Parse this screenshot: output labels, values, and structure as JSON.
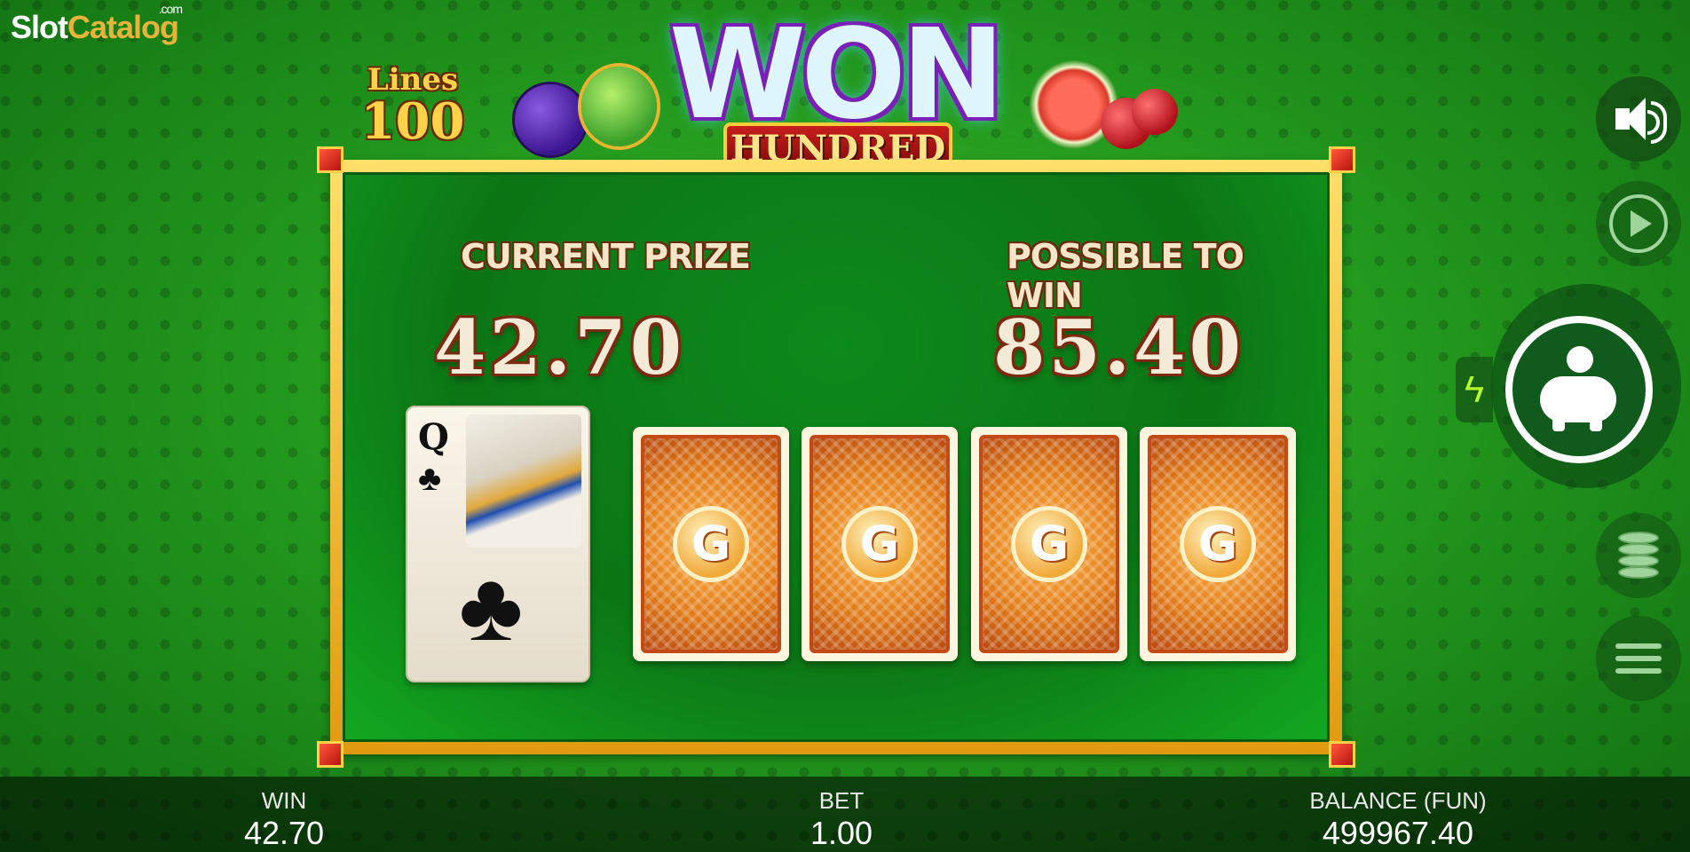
{
  "watermark": {
    "part1": "Slot",
    "part2": "Catalog",
    "suffix": ".com"
  },
  "header": {
    "lines_label": "Lines",
    "lines_value": "100",
    "title_main": "WON",
    "title_sub": "HUNDRED"
  },
  "gamble": {
    "current_prize_label": "CURRENT PRIZE",
    "current_prize_value": "42.70",
    "possible_label": "POSSIBLE TO WIN",
    "possible_value": "85.40",
    "revealed_card": {
      "rank": "Q",
      "suit": "♣"
    },
    "hidden_cards": [
      "G",
      "G",
      "G",
      "G"
    ]
  },
  "icons": {
    "sound": "speaker-icon",
    "autoplay": "autoplay-icon",
    "collect": "piggy-bank-icon",
    "turbo": "lightning-icon",
    "stake": "coins-icon",
    "menu": "menu-icon",
    "turbo_glyph": "ϟ"
  },
  "status_bar": {
    "win_label": "WIN",
    "win_value": "42.70",
    "bet_label": "BET",
    "bet_value": "1.00",
    "balance_label": "BALANCE (FUN)",
    "balance_value": "499967.40"
  },
  "colors": {
    "background": "#239a1e",
    "panel_frame": "#ffd24a",
    "panel_fill": "#0c7515",
    "card_back": "#e07a18"
  }
}
